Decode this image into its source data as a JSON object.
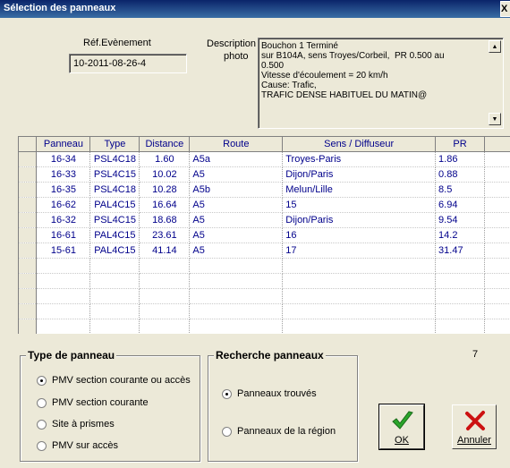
{
  "window": {
    "title": "Sélection des panneaux",
    "close_label": "X"
  },
  "ref": {
    "label": "Réf.Evènement",
    "value": "10-2011-08-26-4"
  },
  "description": {
    "label_line1": "Description",
    "label_line2": "photo",
    "text": "Bouchon 1 Terminé\nsur B104A, sens Troyes/Corbeil,  PR 0.500 au\n0.500\nVitesse d'écoulement = 20 km/h\nCause: Trafic,\nTRAFIC DENSE HABITUEL DU MATIN@"
  },
  "table": {
    "columns": [
      "Panneau",
      "Type",
      "Distance",
      "Route",
      "Sens / Diffuseur",
      "PR"
    ],
    "rows": [
      [
        "16-34",
        "PSL4C18",
        "1.60",
        "A5a",
        "Troyes-Paris",
        "1.86"
      ],
      [
        "16-33",
        "PSL4C15",
        "10.02",
        "A5",
        "Dijon/Paris",
        "0.88"
      ],
      [
        "16-35",
        "PSL4C18",
        "10.28",
        "A5b",
        "Melun/Lille",
        "8.5"
      ],
      [
        "16-62",
        "PAL4C15",
        "16.64",
        "A5",
        "15",
        "6.94"
      ],
      [
        "16-32",
        "PSL4C15",
        "18.68",
        "A5",
        "Dijon/Paris",
        "9.54"
      ],
      [
        "16-61",
        "PAL4C15",
        "23.61",
        "A5",
        "16",
        "14.2"
      ],
      [
        "15-61",
        "PAL4C15",
        "41.14",
        "A5",
        "17",
        "31.47"
      ]
    ]
  },
  "type_panneau": {
    "title": "Type de panneau",
    "options": [
      "PMV section courante ou accès",
      "PMV section courante",
      "Site à prismes",
      "PMV sur accès"
    ],
    "selected_index": 0
  },
  "recherche": {
    "title": "Recherche panneaux",
    "options": [
      "Panneaux trouvés",
      "Panneaux de la région"
    ],
    "selected_index": 0
  },
  "count": "7",
  "buttons": {
    "ok": "OK",
    "cancel": "Annuler"
  },
  "colors": {
    "title_bar": "#0a246a",
    "grid_text": "#00008b",
    "ok_icon": "#2aa52a",
    "cancel_icon": "#cc1111"
  }
}
